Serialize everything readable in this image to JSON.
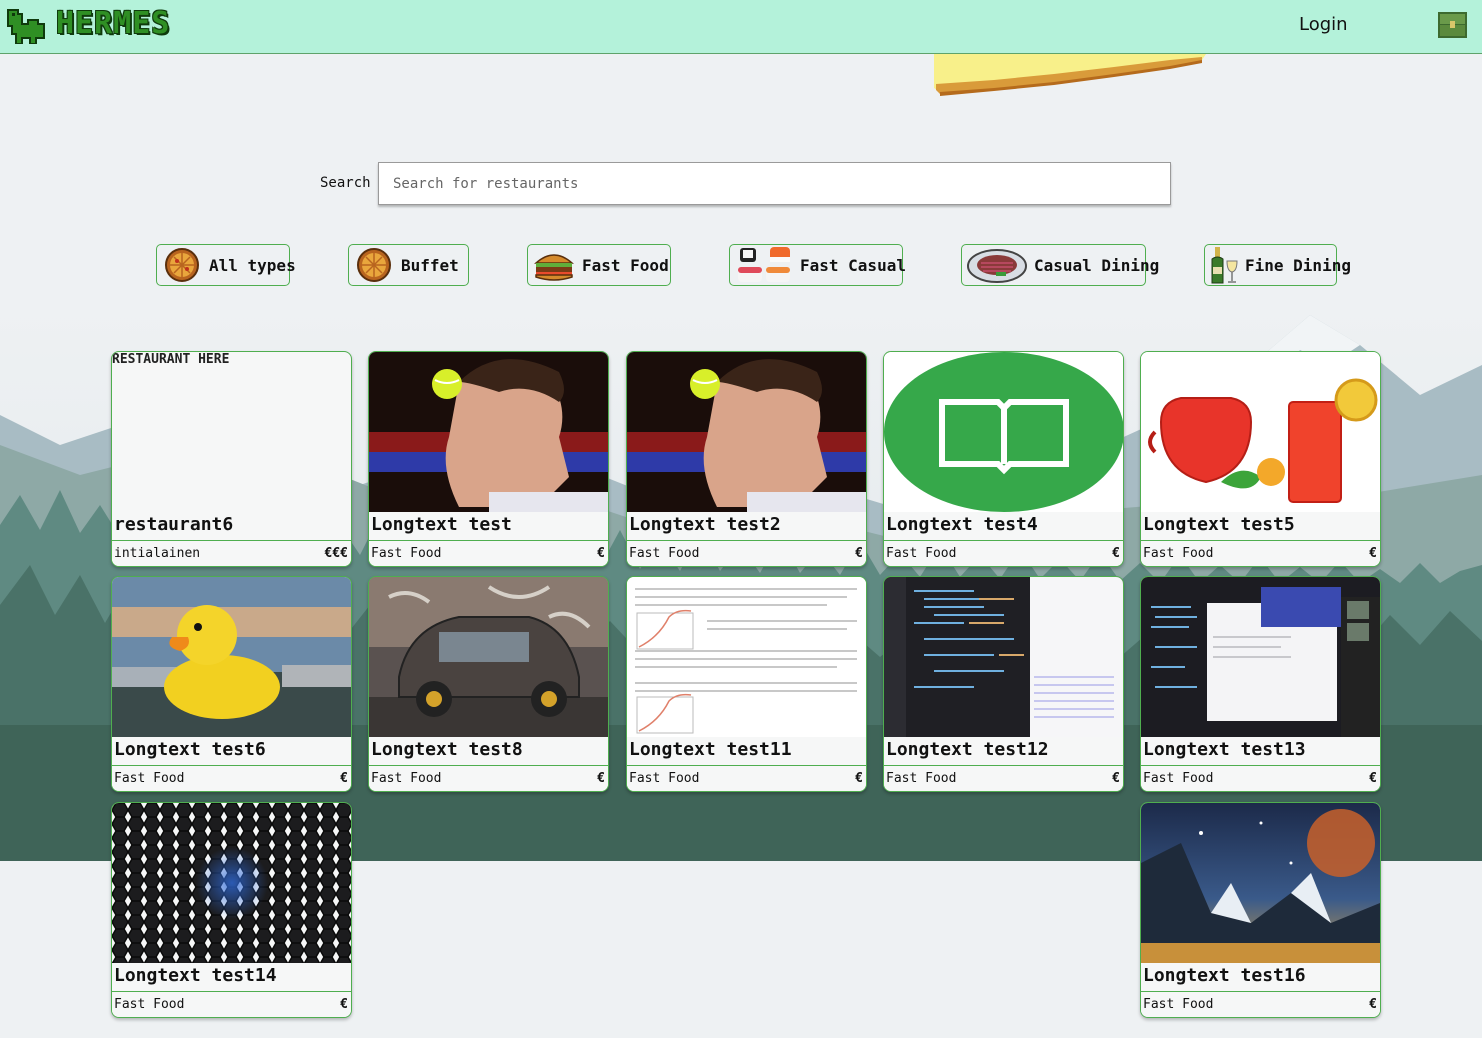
{
  "header": {
    "logo_text": "HERMES",
    "login_label": "Login"
  },
  "search": {
    "label": "Search",
    "placeholder": "Search for restaurants",
    "value": ""
  },
  "filters": [
    {
      "label": "All types",
      "icon": "pizza-icon"
    },
    {
      "label": "Buffet",
      "icon": "pizza-icon"
    },
    {
      "label": "Fast Food",
      "icon": "burger-icon"
    },
    {
      "label": "Fast Casual",
      "icon": "sushi-icon"
    },
    {
      "label": "Casual Dining",
      "icon": "steak-icon"
    },
    {
      "label": "Fine Dining",
      "icon": "wine-icon"
    }
  ],
  "restaurants": [
    {
      "name": "restaurant6",
      "type": "intialainen",
      "price": "€€€",
      "image": "broken-image",
      "alt": "RESTAURANT HERE"
    },
    {
      "name": "Longtext test",
      "type": "Fast Food",
      "price": "€",
      "image": "tennis-player-photo"
    },
    {
      "name": "Longtext test2",
      "type": "Fast Food",
      "price": "€",
      "image": "tennis-player-photo"
    },
    {
      "name": "Longtext test4",
      "type": "Fast Food",
      "price": "€",
      "image": "book-logo"
    },
    {
      "name": "Longtext test5",
      "type": "Fast Food",
      "price": "€",
      "image": "drinks-photo"
    },
    {
      "name": "Longtext test6",
      "type": "Fast Food",
      "price": "€",
      "image": "rubber-duck-photo"
    },
    {
      "name": "Longtext test8",
      "type": "Fast Food",
      "price": "€",
      "image": "car-graffiti-photo"
    },
    {
      "name": "Longtext test11",
      "type": "Fast Food",
      "price": "€",
      "image": "document-screenshot"
    },
    {
      "name": "Longtext test12",
      "type": "Fast Food",
      "price": "€",
      "image": "code-editor-screenshot"
    },
    {
      "name": "Longtext test13",
      "type": "Fast Food",
      "price": "€",
      "image": "code-editor-screenshot"
    },
    {
      "name": "Longtext test14",
      "type": "Fast Food",
      "price": "€",
      "image": "hexagon-pattern"
    },
    {
      "name": "Longtext test16",
      "type": "Fast Food",
      "price": "€",
      "image": "space-landscape"
    }
  ],
  "colors": {
    "header_bg": "#b4f2da",
    "accent_green": "#4fae4f",
    "page_bg": "#eef1f3",
    "forest_dark": "#3f5f55"
  }
}
